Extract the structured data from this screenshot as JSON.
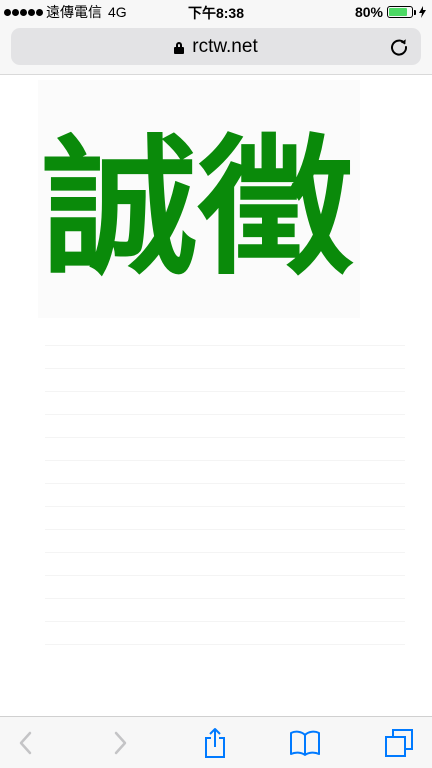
{
  "status_bar": {
    "carrier": "遠傳電信",
    "network": "4G",
    "time": "下午8:38",
    "battery_percent_text": "80%",
    "battery_level": 0.8
  },
  "address_bar": {
    "url": "rctw.net",
    "secure": true
  },
  "page": {
    "logo_text": "誠徵",
    "logo_color": "#0a8a0a"
  },
  "toolbar": {
    "back_icon": "back-chevron-icon",
    "forward_icon": "forward-chevron-icon",
    "share_icon": "share-icon",
    "bookmarks_icon": "bookmarks-book-icon",
    "tabs_icon": "tabs-icon",
    "accent": "#007aff"
  }
}
